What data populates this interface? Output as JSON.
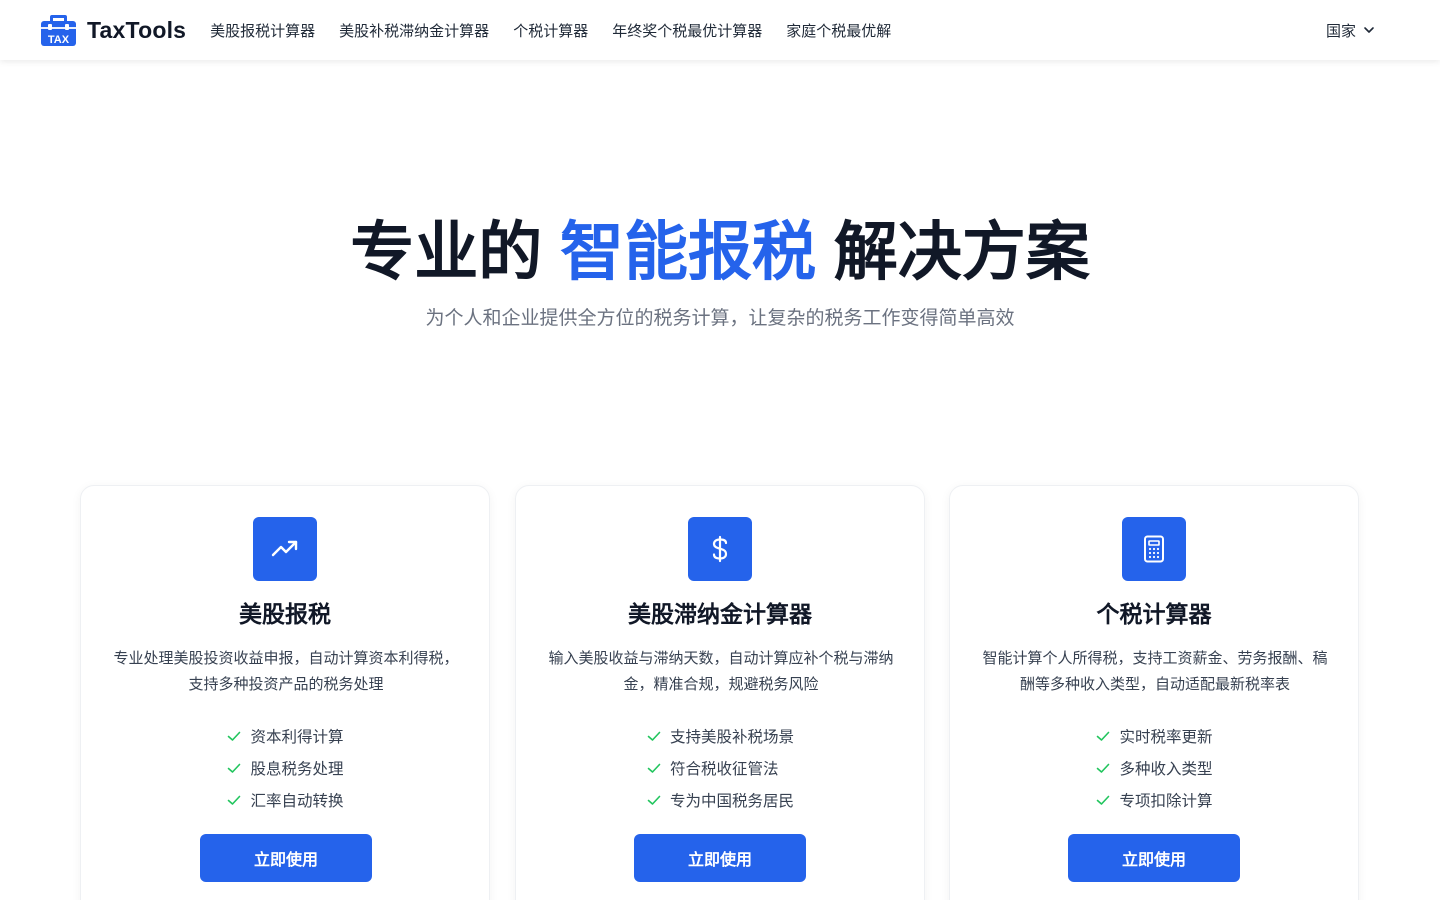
{
  "header": {
    "logo_text": "TaxTools",
    "logo_badge": "TAX",
    "nav": [
      {
        "label": "美股报税计算器"
      },
      {
        "label": "美股补税滞纳金计算器"
      },
      {
        "label": "个税计算器"
      },
      {
        "label": "年终奖个税最优计算器"
      },
      {
        "label": "家庭个税最优解"
      }
    ],
    "country_label": "国家",
    "country_icon": "chevron-down-icon"
  },
  "hero": {
    "title_before": "专业的 ",
    "title_accent": "智能报税",
    "title_after": " 解决方案",
    "subtitle": "为个人和企业提供全方位的税务计算，让复杂的税务工作变得简单高效"
  },
  "colors": {
    "accent": "#2563eb",
    "check": "#22c55e",
    "title": "#111827",
    "muted": "#6b7280"
  },
  "cards": [
    {
      "icon": "trending-up-icon",
      "title": "美股报税",
      "description": "专业处理美股投资收益申报，自动计算资本利得税，支持多种投资产品的税务处理",
      "features": [
        "资本利得计算",
        "股息税务处理",
        "汇率自动转换"
      ],
      "button": "立即使用"
    },
    {
      "icon": "dollar-sign-icon",
      "title": "美股滞纳金计算器",
      "description": "输入美股收益与滞纳天数，自动计算应补个税与滞纳金，精准合规，规避税务风险",
      "features": [
        "支持美股补税场景",
        "符合税收征管法",
        "专为中国税务居民"
      ],
      "button": "立即使用"
    },
    {
      "icon": "calculator-icon",
      "title": "个税计算器",
      "description": "智能计算个人所得税，支持工资薪金、劳务报酬、稿酬等多种收入类型，自动适配最新税率表",
      "features": [
        "实时税率更新",
        "多种收入类型",
        "专项扣除计算"
      ],
      "button": "立即使用"
    }
  ]
}
